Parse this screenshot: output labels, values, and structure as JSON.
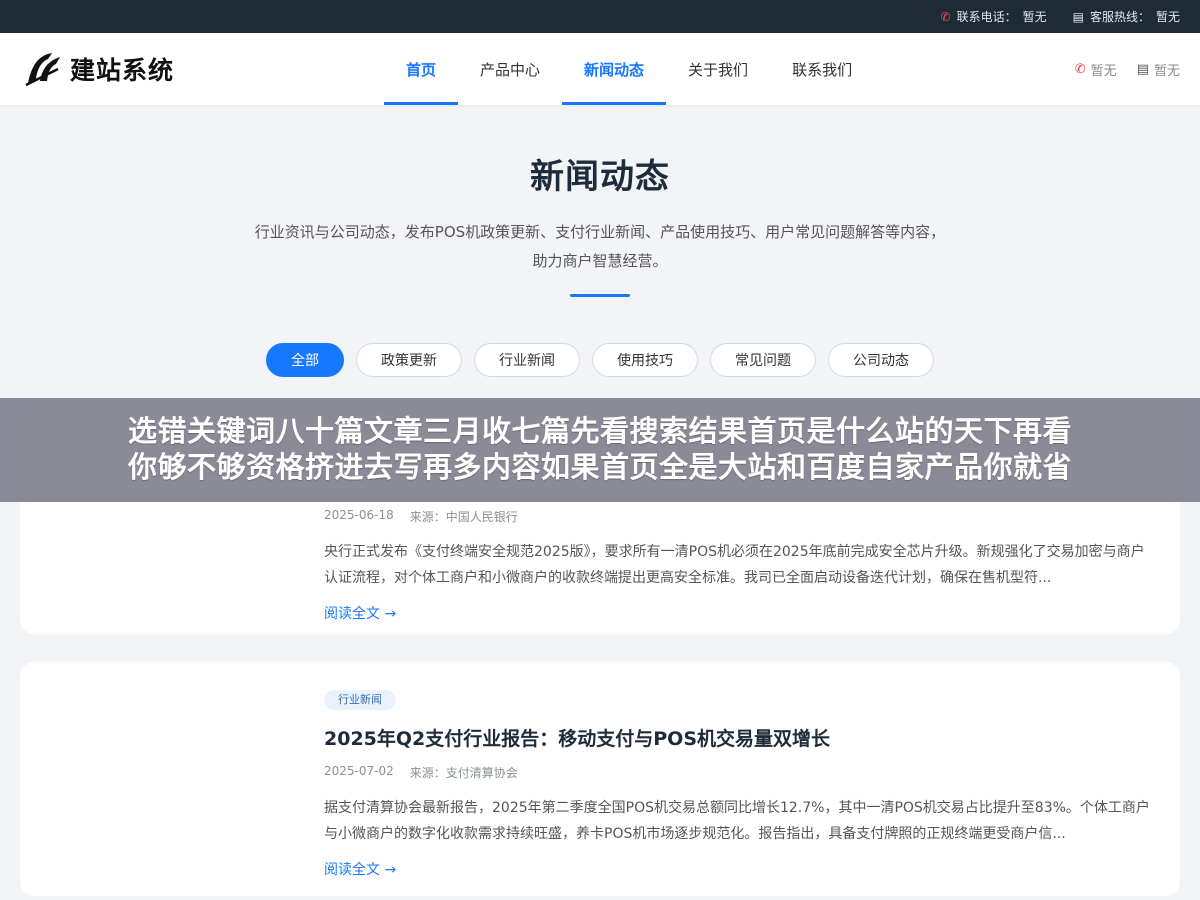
{
  "topbar": {
    "phone_label": "联系电话：",
    "phone_value": "暂无",
    "hotline_label": "客服热线：",
    "hotline_value": "暂无",
    "phone_icon": "phone-icon",
    "chat_icon": "chat-icon"
  },
  "header": {
    "logo_text": "建站系统",
    "nav": [
      {
        "label": "首页",
        "active": true
      },
      {
        "label": "产品中心",
        "active": false
      },
      {
        "label": "新闻动态",
        "active": true
      },
      {
        "label": "关于我们",
        "active": false
      },
      {
        "label": "联系我们",
        "active": false
      }
    ],
    "phone_value": "暂无",
    "chat_value": "暂无"
  },
  "hero": {
    "title": "新闻动态",
    "description": "行业资讯与公司动态，发布POS机政策更新、支付行业新闻、产品使用技巧、用户常见问题解答等内容，助力商户智慧经营。"
  },
  "filters": [
    {
      "label": "全部",
      "active": true
    },
    {
      "label": "政策更新",
      "active": false
    },
    {
      "label": "行业新闻",
      "active": false
    },
    {
      "label": "使用技巧",
      "active": false
    },
    {
      "label": "常见问题",
      "active": false
    },
    {
      "label": "公司动态",
      "active": false
    }
  ],
  "articles": [
    {
      "tag": "",
      "title": "",
      "date": "2025-06-18",
      "source": "来源：中国人民银行",
      "excerpt": "央行正式发布《支付终端安全规范2025版》，要求所有一清POS机必须在2025年底前完成安全芯片升级。新规强化了交易加密与商户认证流程，对个体工商户和小微商户的收款终端提出更高安全标准。我司已全面启动设备迭代计划，确保在售机型符...",
      "read_more": "阅读全文 →"
    },
    {
      "tag": "行业新闻",
      "title": "2025年Q2支付行业报告：移动支付与POS机交易量双增长",
      "date": "2025-07-02",
      "source": "来源：支付清算协会",
      "excerpt": "据支付清算协会最新报告，2025年第二季度全国POS机交易总额同比增长12.7%，其中一清POS机交易占比提升至83%。个体工商户与小微商户的数字化收款需求持续旺盛，养卡POS机市场逐步规范化。报告指出，具备支付牌照的正规终端更受商户信...",
      "read_more": "阅读全文 →"
    }
  ],
  "overlay": {
    "line1": "选错关键词八十篇文章三月收七篇先看搜索结果首页是什么站的天下再看",
    "line2": "你够不够资格挤进去写再多内容如果首页全是大站和百度自家产品你就省"
  },
  "colors": {
    "accent": "#1677ff",
    "topbar_bg": "#1f2a37",
    "page_bg": "#f2f4f7"
  }
}
